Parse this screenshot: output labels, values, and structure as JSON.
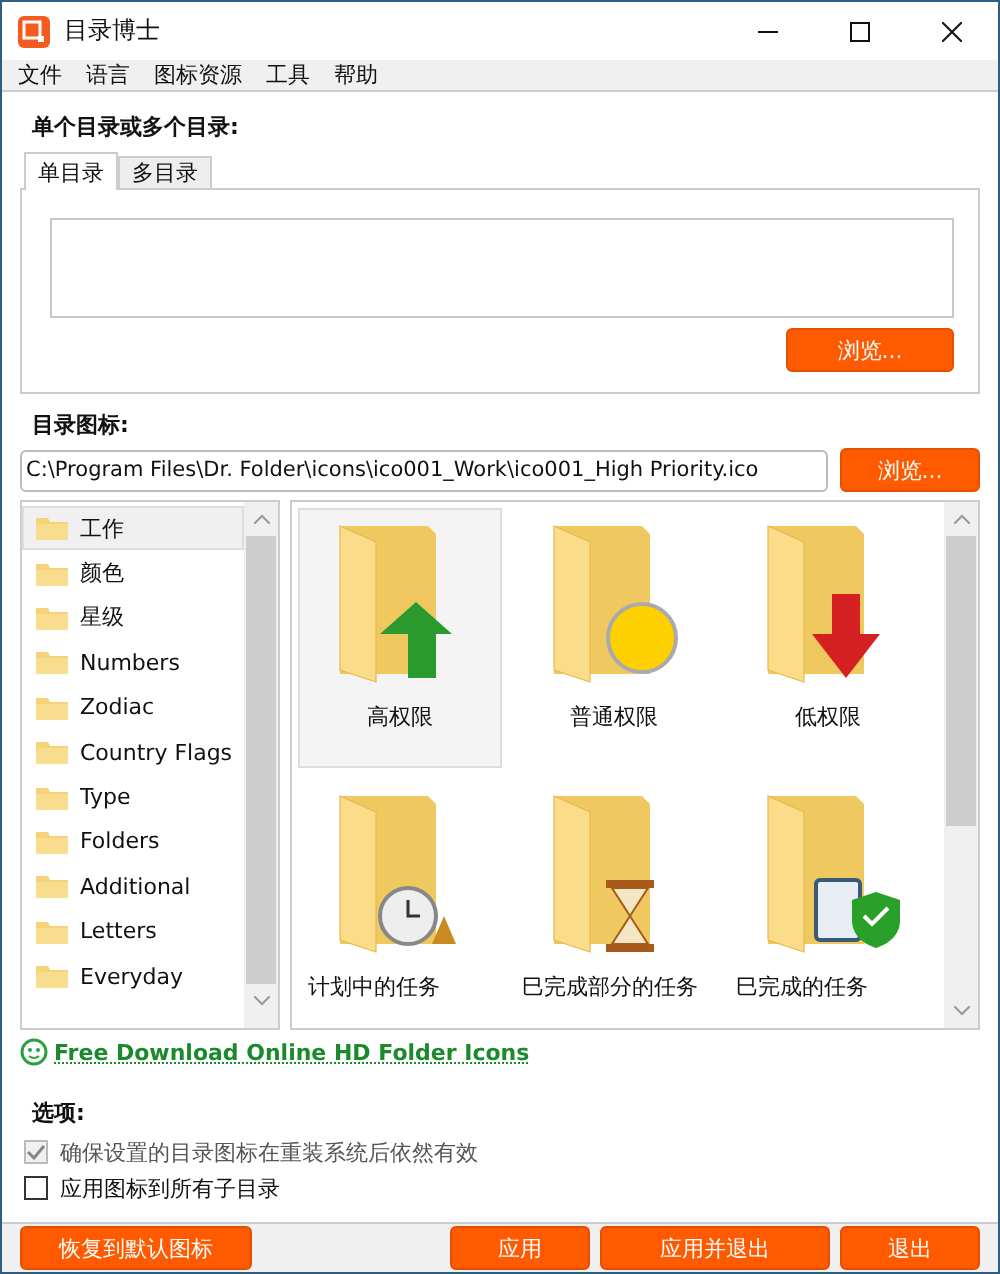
{
  "window": {
    "title": "目录博士"
  },
  "menu": [
    "文件",
    "语言",
    "图标资源",
    "工具",
    "帮助"
  ],
  "folder_section": {
    "label": "单个目录或多个目录:",
    "tabs": [
      {
        "label": "单目录",
        "selected": true
      },
      {
        "label": "多目录",
        "selected": false
      }
    ],
    "browse": "浏览..."
  },
  "icon_section": {
    "label": "目录图标:",
    "path": "C:\\Program Files\\Dr. Folder\\icons\\ico001_Work\\ico001_High Priority.ico",
    "browse": "浏览..."
  },
  "categories": [
    {
      "label": "工作",
      "selected": true
    },
    {
      "label": "颜色",
      "selected": false
    },
    {
      "label": "星级",
      "selected": false
    },
    {
      "label": "Numbers",
      "selected": false
    },
    {
      "label": "Zodiac",
      "selected": false
    },
    {
      "label": "Country Flags",
      "selected": false
    },
    {
      "label": "Type",
      "selected": false
    },
    {
      "label": "Folders",
      "selected": false
    },
    {
      "label": "Additional",
      "selected": false
    },
    {
      "label": "Letters",
      "selected": false
    },
    {
      "label": "Everyday",
      "selected": false
    }
  ],
  "icons": [
    {
      "label": "高权限",
      "kind": "up",
      "selected": true
    },
    {
      "label": "普通权限",
      "kind": "circle",
      "selected": false
    },
    {
      "label": "低权限",
      "kind": "down",
      "selected": false
    },
    {
      "label": "计划中的任务",
      "kind": "clock",
      "selected": false
    },
    {
      "label": "巳完成部分的任务",
      "kind": "hourglass",
      "selected": false
    },
    {
      "label": "巳完成的任务",
      "kind": "clipboard",
      "selected": false
    }
  ],
  "download_link": "Free Download Online HD Folder Icons",
  "options": {
    "label": "选项:",
    "items": [
      {
        "label": "确保设置的目录图标在重装系统后依然有效",
        "checked": true,
        "disabled": true
      },
      {
        "label": "应用图标到所有子目录",
        "checked": false,
        "disabled": false
      }
    ]
  },
  "buttons": {
    "reset": "恢复到默认图标",
    "actions": [
      "应用",
      "应用并退出",
      "退出"
    ]
  }
}
